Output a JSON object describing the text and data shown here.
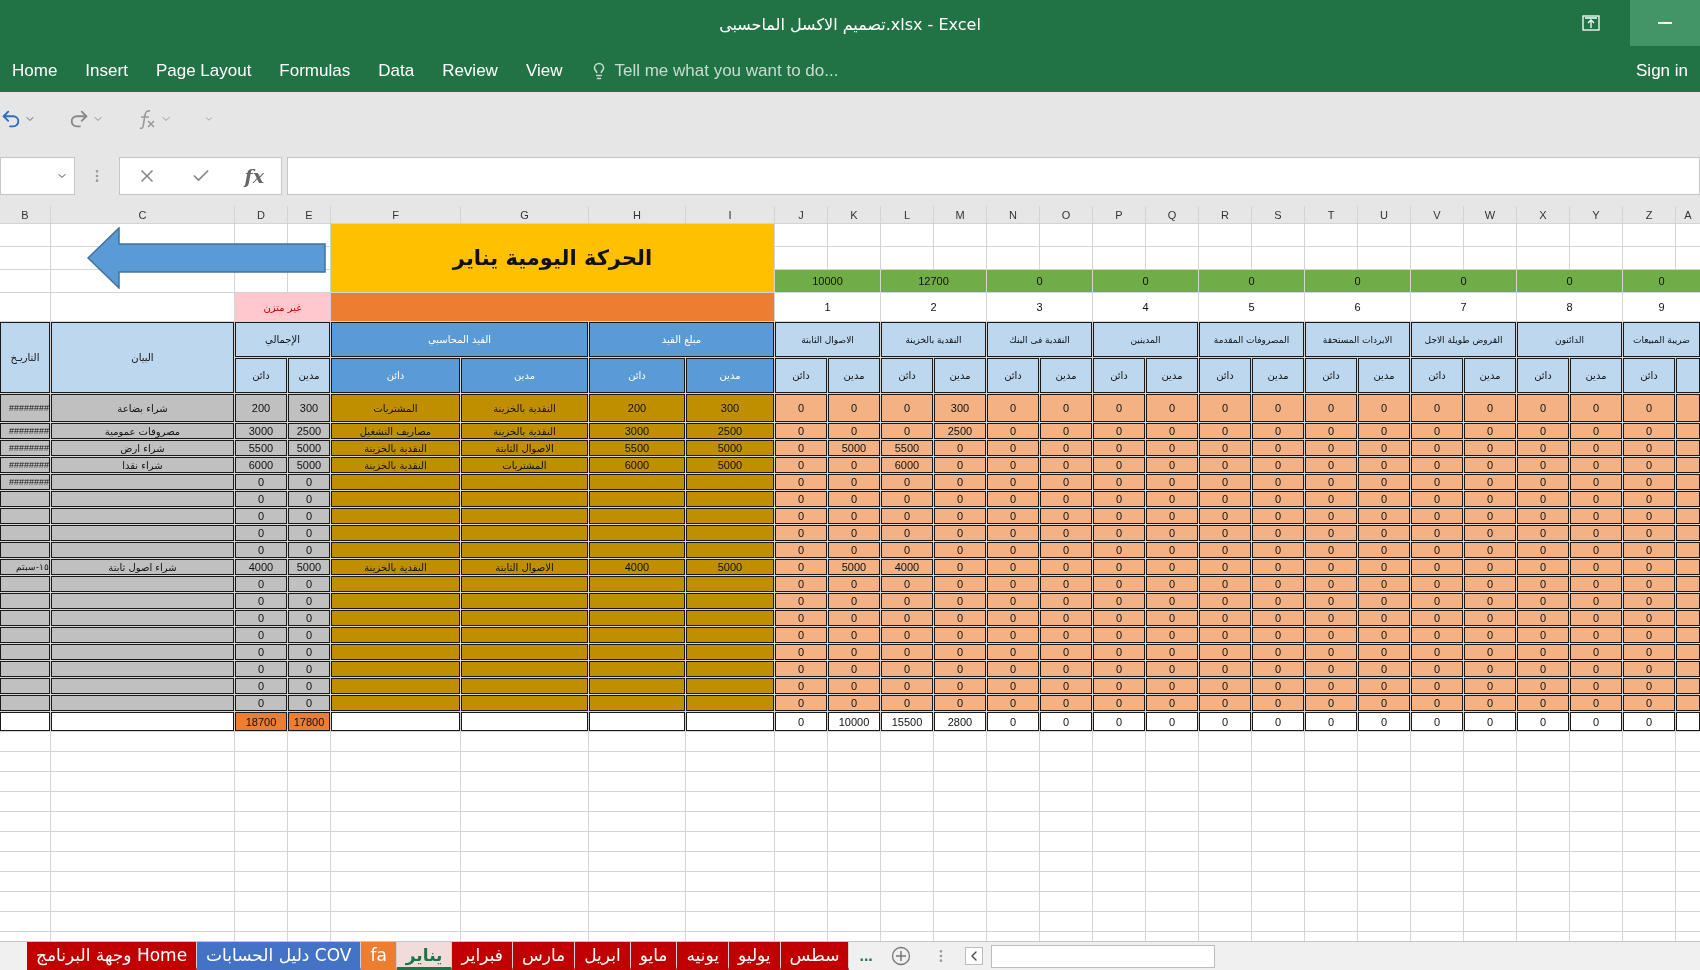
{
  "window": {
    "title": "تصميم الاكسل الماحسبى.xlsx - Excel"
  },
  "menu": [
    "View",
    "Review",
    "Data",
    "Formulas",
    "Page Layout",
    "Insert",
    "Home"
  ],
  "tell_me": "Tell me what you want to do...",
  "sign_in": "Sign in",
  "formula_bar": {
    "fx": "fx"
  },
  "column_letters": [
    "A",
    "Z",
    "Y",
    "X",
    "W",
    "V",
    "U",
    "T",
    "S",
    "R",
    "Q",
    "P",
    "O",
    "N",
    "M",
    "L",
    "K",
    "J",
    "I",
    "H",
    "G",
    "F",
    "E",
    "D",
    "C",
    "B"
  ],
  "sheet": {
    "title": "الحركة اليومية يناير",
    "balance_status": "غير متزن",
    "account_totals": [
      "0",
      "0",
      "0",
      "0",
      "0",
      "0",
      "0",
      "12700",
      "10000"
    ],
    "account_numbers": [
      "9",
      "8",
      "7",
      "6",
      "5",
      "4",
      "3",
      "2",
      "1"
    ],
    "headers": {
      "date": "التاريـخ",
      "description": "البيان",
      "total": "الإجمالي",
      "entry": "القيد المحاسبي",
      "amount": "مبلغ القيد"
    },
    "accounts": [
      "ضريبة المبيعات",
      "الدائنون",
      "القروض طويلة الاجل",
      "الايردات المستحقة",
      "المصروفات المقدمة",
      "المدينين",
      "النقدية فى البنك",
      "النقدية بالخزينة",
      "الاصوال الثابتة"
    ],
    "sub_headers": [
      "دائن",
      "مدين",
      "دائن",
      "مدين",
      "دائن",
      "مدين",
      "دائن",
      "مدين",
      "دائن",
      "مدين",
      "دائن",
      "مدين",
      "دائن",
      "مدين",
      "دائن",
      "مدين",
      "دائن",
      "مدين",
      "دائن",
      "مدين",
      "دائن",
      "مدين",
      "دائن"
    ],
    "rows": [
      {
        "date": "########",
        "description": "شراء بضاعة",
        "total_credit": "200",
        "total_debit": "300",
        "credit_account": "المشتريات",
        "debit_account": "النقدية بالخزينة",
        "credit_amount": "200",
        "debit_amount": "300",
        "accounts": [
          "0",
          "0",
          "0",
          "0",
          "0",
          "0",
          "0",
          "0",
          "0",
          "0",
          "0",
          "0",
          "0",
          "300",
          "0",
          "0",
          "0"
        ]
      },
      {
        "date": "########",
        "description": "مصروفات عمومية",
        "total_credit": "3000",
        "total_debit": "2500",
        "credit_account": "مصاريف التشغيل",
        "debit_account": "النقدية بالخزينة",
        "credit_amount": "3000",
        "debit_amount": "2500",
        "accounts": [
          "0",
          "0",
          "0",
          "0",
          "0",
          "0",
          "0",
          "0",
          "0",
          "0",
          "0",
          "0",
          "0",
          "2500",
          "0",
          "0",
          "0"
        ]
      },
      {
        "date": "########",
        "description": "شراء ارض",
        "total_credit": "5500",
        "total_debit": "5000",
        "credit_account": "النقدية بالخزينة",
        "debit_account": "الاصوال الثابتة",
        "credit_amount": "5500",
        "debit_amount": "5000",
        "accounts": [
          "0",
          "0",
          "0",
          "0",
          "0",
          "0",
          "0",
          "0",
          "0",
          "0",
          "0",
          "0",
          "0",
          "0",
          "5500",
          "5000",
          "0"
        ]
      },
      {
        "date": "########",
        "description": "شراء نقدا",
        "total_credit": "6000",
        "total_debit": "5000",
        "credit_account": "النقدية بالخزينة",
        "debit_account": "المشتريات",
        "credit_amount": "6000",
        "debit_amount": "5000",
        "accounts": [
          "0",
          "0",
          "0",
          "0",
          "0",
          "0",
          "0",
          "0",
          "0",
          "0",
          "0",
          "0",
          "0",
          "0",
          "6000",
          "0",
          "0"
        ]
      },
      {
        "date": "########",
        "total_credit": "0",
        "total_debit": "0",
        "accounts": [
          "0",
          "0",
          "0",
          "0",
          "0",
          "0",
          "0",
          "0",
          "0",
          "0",
          "0",
          "0",
          "0",
          "0",
          "0",
          "0",
          "0"
        ]
      },
      {
        "total_credit": "0",
        "total_debit": "0",
        "accounts": [
          "0",
          "0",
          "0",
          "0",
          "0",
          "0",
          "0",
          "0",
          "0",
          "0",
          "0",
          "0",
          "0",
          "0",
          "0",
          "0",
          "0"
        ]
      },
      {
        "total_credit": "0",
        "total_debit": "0",
        "accounts": [
          "0",
          "0",
          "0",
          "0",
          "0",
          "0",
          "0",
          "0",
          "0",
          "0",
          "0",
          "0",
          "0",
          "0",
          "0",
          "0",
          "0"
        ]
      },
      {
        "total_credit": "0",
        "total_debit": "0",
        "accounts": [
          "0",
          "0",
          "0",
          "0",
          "0",
          "0",
          "0",
          "0",
          "0",
          "0",
          "0",
          "0",
          "0",
          "0",
          "0",
          "0",
          "0"
        ]
      },
      {
        "total_credit": "0",
        "total_debit": "0",
        "accounts": [
          "0",
          "0",
          "0",
          "0",
          "0",
          "0",
          "0",
          "0",
          "0",
          "0",
          "0",
          "0",
          "0",
          "0",
          "0",
          "0",
          "0"
        ]
      },
      {
        "date": "١٥-سبتم",
        "description": "شراء اصول ثابتة",
        "total_credit": "4000",
        "total_debit": "5000",
        "credit_account": "النقدية بالخزينة",
        "debit_account": "الاصوال الثابتة",
        "credit_amount": "4000",
        "debit_amount": "5000",
        "accounts": [
          "0",
          "0",
          "0",
          "0",
          "0",
          "0",
          "0",
          "0",
          "0",
          "0",
          "0",
          "0",
          "0",
          "0",
          "4000",
          "5000",
          "0"
        ]
      },
      {
        "total_credit": "0",
        "total_debit": "0",
        "accounts": [
          "0",
          "0",
          "0",
          "0",
          "0",
          "0",
          "0",
          "0",
          "0",
          "0",
          "0",
          "0",
          "0",
          "0",
          "0",
          "0",
          "0"
        ]
      },
      {
        "total_credit": "0",
        "total_debit": "0",
        "accounts": [
          "0",
          "0",
          "0",
          "0",
          "0",
          "0",
          "0",
          "0",
          "0",
          "0",
          "0",
          "0",
          "0",
          "0",
          "0",
          "0",
          "0"
        ]
      },
      {
        "total_credit": "0",
        "total_debit": "0",
        "accounts": [
          "0",
          "0",
          "0",
          "0",
          "0",
          "0",
          "0",
          "0",
          "0",
          "0",
          "0",
          "0",
          "0",
          "0",
          "0",
          "0",
          "0"
        ]
      },
      {
        "total_credit": "0",
        "total_debit": "0",
        "accounts": [
          "0",
          "0",
          "0",
          "0",
          "0",
          "0",
          "0",
          "0",
          "0",
          "0",
          "0",
          "0",
          "0",
          "0",
          "0",
          "0",
          "0"
        ]
      },
      {
        "total_credit": "0",
        "total_debit": "0",
        "accounts": [
          "0",
          "0",
          "0",
          "0",
          "0",
          "0",
          "0",
          "0",
          "0",
          "0",
          "0",
          "0",
          "0",
          "0",
          "0",
          "0",
          "0"
        ]
      },
      {
        "total_credit": "0",
        "total_debit": "0",
        "accounts": [
          "0",
          "0",
          "0",
          "0",
          "0",
          "0",
          "0",
          "0",
          "0",
          "0",
          "0",
          "0",
          "0",
          "0",
          "0",
          "0",
          "0"
        ]
      },
      {
        "total_credit": "0",
        "total_debit": "0",
        "accounts": [
          "0",
          "0",
          "0",
          "0",
          "0",
          "0",
          "0",
          "0",
          "0",
          "0",
          "0",
          "0",
          "0",
          "0",
          "0",
          "0",
          "0"
        ]
      },
      {
        "total_credit": "0",
        "total_debit": "0",
        "accounts": [
          "0",
          "0",
          "0",
          "0",
          "0",
          "0",
          "0",
          "0",
          "0",
          "0",
          "0",
          "0",
          "0",
          "0",
          "0",
          "0",
          "0"
        ]
      }
    ],
    "totals": {
      "credit": "18700",
      "debit": "17800",
      "accounts": [
        "0",
        "0",
        "0",
        "0",
        "0",
        "0",
        "0",
        "0",
        "0",
        "0",
        "0",
        "0",
        "0",
        "2800",
        "15500",
        "10000",
        "0"
      ]
    }
  },
  "sheet_tabs": [
    {
      "label": "سطس",
      "selected": false,
      "color": "#c00000"
    },
    {
      "label": "يوليو",
      "selected": false,
      "color": "#c00000"
    },
    {
      "label": "يونيه",
      "selected": false,
      "color": "#c00000"
    },
    {
      "label": "مايو",
      "selected": false,
      "color": "#c00000"
    },
    {
      "label": "ابريل",
      "selected": false,
      "color": "#c00000"
    },
    {
      "label": "مارس",
      "selected": false,
      "color": "#c00000"
    },
    {
      "label": "فبراير",
      "selected": false,
      "color": "#c00000"
    },
    {
      "label": "يناير",
      "selected": true,
      "color": "#f2dcdb"
    },
    {
      "label": "fa",
      "selected": false,
      "color": "#ed7d31"
    },
    {
      "label": "دليل الحسابات COV",
      "selected": false,
      "color": "#4472c4"
    },
    {
      "label": "وجهة البرنامج Home",
      "selected": false,
      "color": "#c00000"
    }
  ],
  "more_tabs": "..."
}
